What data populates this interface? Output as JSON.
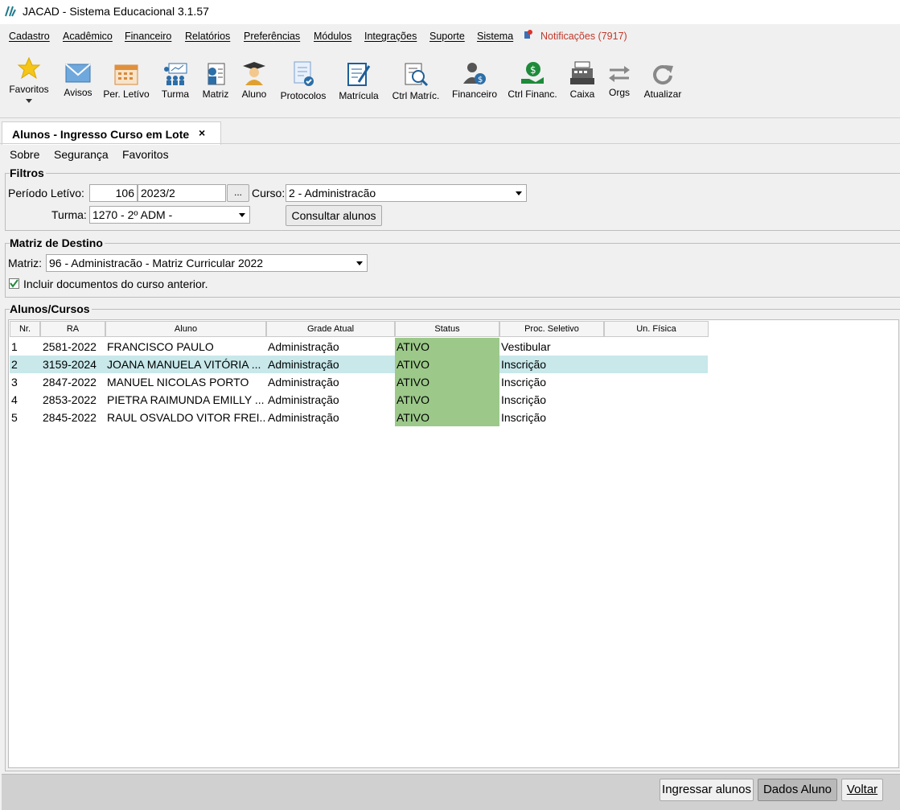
{
  "window": {
    "title": "JACAD - Sistema Educacional 3.1.57"
  },
  "menubar": {
    "items": [
      "Cadastro",
      "Acadêmico",
      "Financeiro",
      "Relatórios",
      "Preferências",
      "Módulos",
      "Integrações",
      "Suporte",
      "Sistema"
    ],
    "notifications": "Notificações (7917)"
  },
  "toolbar": {
    "items": [
      {
        "label": "Favoritos",
        "icon": "star-icon"
      },
      {
        "label": "Avisos",
        "icon": "envelope-icon"
      },
      {
        "label": "Per. Letívo",
        "icon": "calendar-icon"
      },
      {
        "label": "Turma",
        "icon": "class-group-icon"
      },
      {
        "label": "Matriz",
        "icon": "curriculum-icon"
      },
      {
        "label": "Aluno",
        "icon": "student-icon"
      },
      {
        "label": "Protocolos",
        "icon": "protocol-document-icon"
      },
      {
        "label": "Matrícula",
        "icon": "enrollment-edit-icon"
      },
      {
        "label": "Ctrl Matríc.",
        "icon": "enrollment-search-icon"
      },
      {
        "label": "Financeiro",
        "icon": "finance-person-icon"
      },
      {
        "label": "Ctrl Financ.",
        "icon": "money-hand-icon"
      },
      {
        "label": "Caixa",
        "icon": "cash-register-icon"
      },
      {
        "label": "Orgs",
        "icon": "swap-arrows-icon"
      },
      {
        "label": "Atualizar",
        "icon": "refresh-icon"
      }
    ]
  },
  "tab": {
    "title": "Alunos - Ingresso Curso em Lote",
    "close": "×"
  },
  "submenu": [
    "Sobre",
    "Segurança",
    "Favoritos"
  ],
  "filters": {
    "legend": "Filtros",
    "periodo_label": "Período Letívo:",
    "periodo_code": "106",
    "periodo_value": "2023/2",
    "browse": "...",
    "curso_label": "Curso:",
    "curso_value": "2 - Administracão",
    "turma_label": "Turma:",
    "turma_value": "1270 - 2º ADM -",
    "consultar": "Consultar alunos"
  },
  "destino": {
    "legend": "Matriz de Destino",
    "matriz_label": "Matriz:",
    "matriz_value": "96 - Administracão - Matriz Curricular 2022",
    "incluir_label": "Incluir documentos do curso anterior.",
    "incluir_checked": true
  },
  "alunos": {
    "legend": "Alunos/Cursos",
    "columns": [
      "Nr.",
      "RA",
      "Aluno",
      "Grade Atual",
      "Status",
      "Proc. Seletivo",
      "Un. Física"
    ],
    "rows": [
      {
        "nr": "1",
        "ra": "2581-2022",
        "aluno": "FRANCISCO PAULO",
        "grade": "Administração",
        "status": "ATIVO",
        "proc": "Vestibular",
        "un": ""
      },
      {
        "nr": "2",
        "ra": "3159-2024",
        "aluno": "JOANA MANUELA VITÓRIA ...",
        "grade": "Administração",
        "status": "ATIVO",
        "proc": "Inscrição",
        "un": ""
      },
      {
        "nr": "3",
        "ra": "2847-2022",
        "aluno": "MANUEL NICOLAS PORTO",
        "grade": "Administração",
        "status": "ATIVO",
        "proc": "Inscrição",
        "un": ""
      },
      {
        "nr": "4",
        "ra": "2853-2022",
        "aluno": "PIETRA RAIMUNDA EMILLY ...",
        "grade": "Administração",
        "status": "ATIVO",
        "proc": "Inscrição",
        "un": ""
      },
      {
        "nr": "5",
        "ra": "2845-2022",
        "aluno": "RAUL OSVALDO VITOR FREI...",
        "grade": "Administração",
        "status": "ATIVO",
        "proc": "Inscrição",
        "un": ""
      }
    ],
    "selected_row": 2
  },
  "actions": {
    "ingressar": "Ingressar alunos",
    "dados": "Dados Aluno",
    "voltar": "Voltar"
  },
  "colors": {
    "status_ok": "#9cc98a",
    "selected_row": "#c8e8ea",
    "notification": "#c0392b"
  }
}
